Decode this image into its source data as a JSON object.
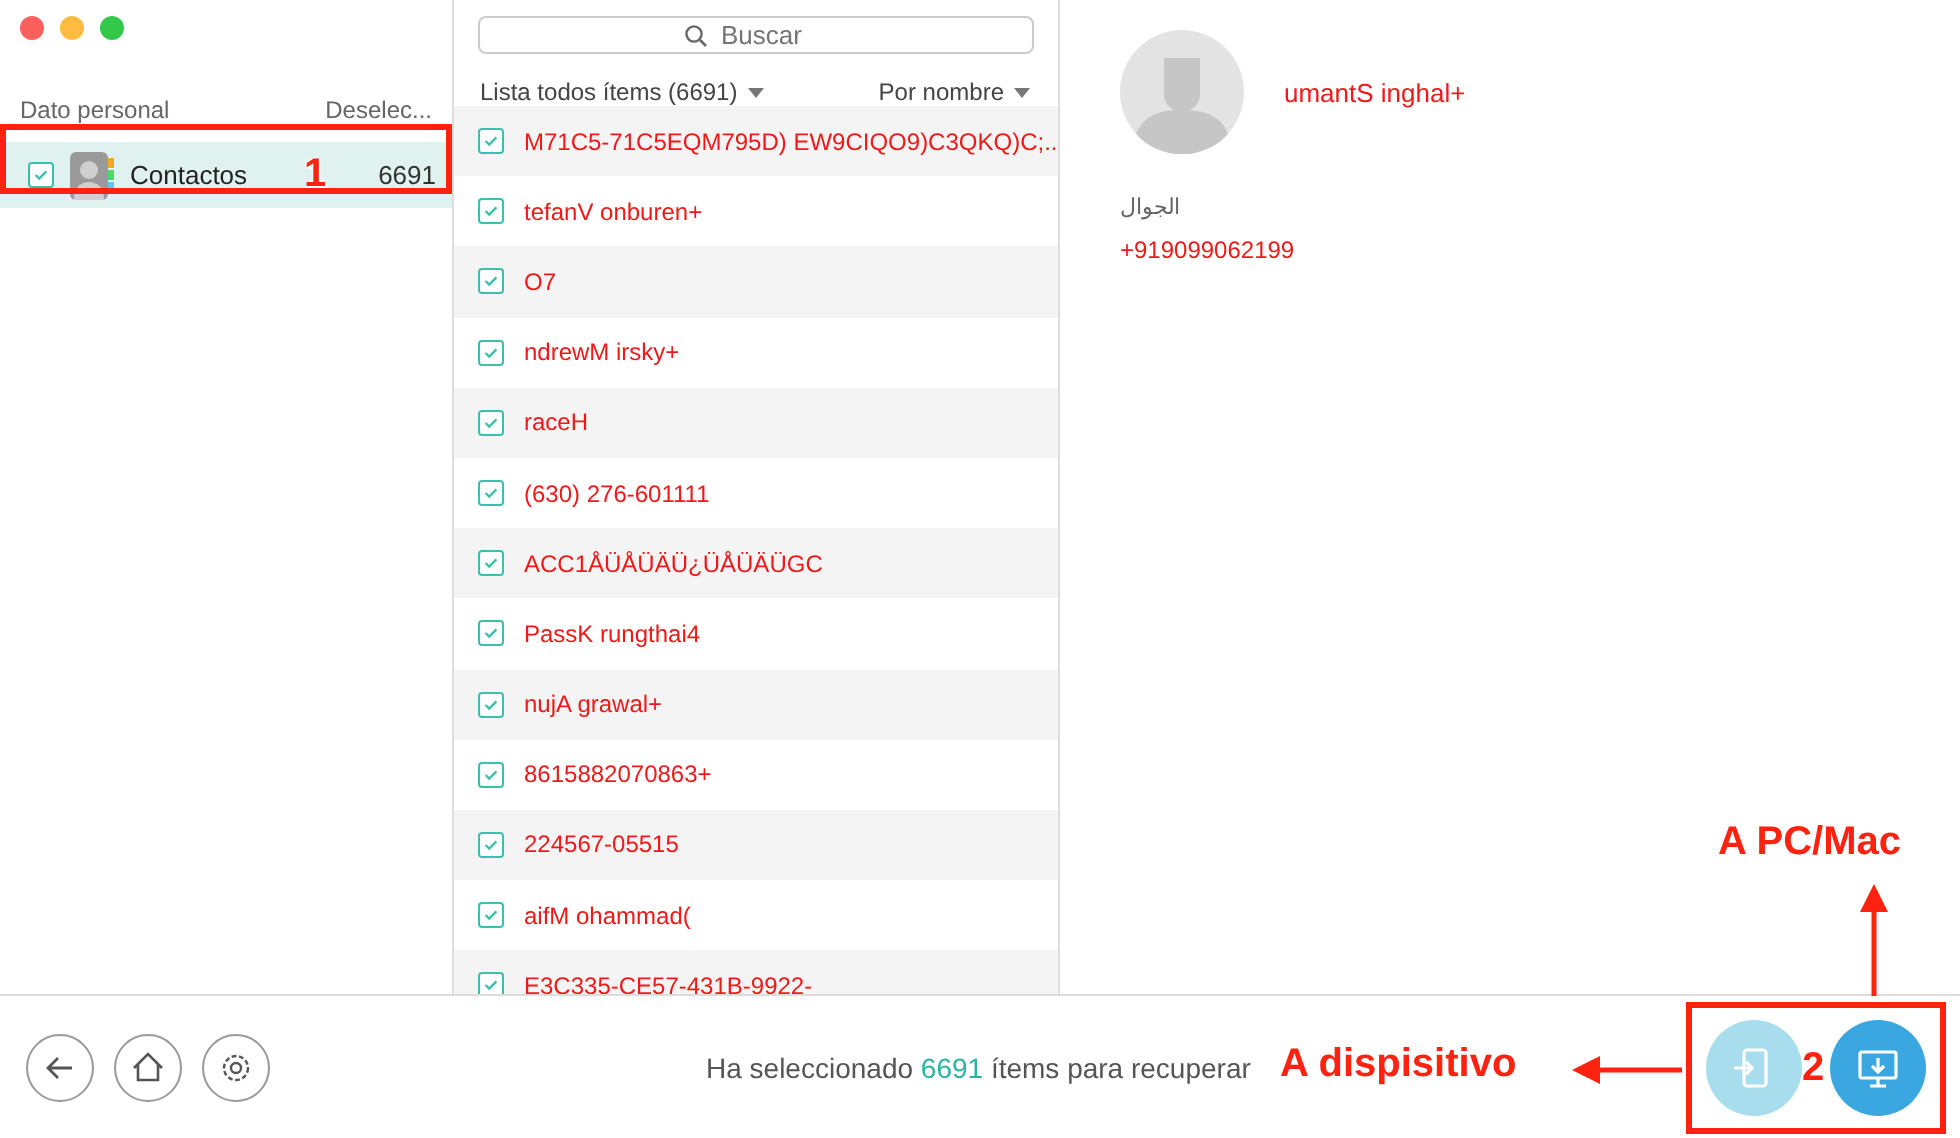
{
  "sidebar": {
    "heading": "Dato personal",
    "action": "Deselec...",
    "items": [
      {
        "label": "Contactos",
        "count": "6691",
        "checked": true,
        "selected": true,
        "badge": "1"
      }
    ]
  },
  "search": {
    "placeholder": "Buscar"
  },
  "list": {
    "filter": "Lista todos ítems (6691)",
    "sort": "Por nombre",
    "rows": [
      {
        "label": "M71C5-71C5EQM795D) EW9CIQO9)C3QKQ)C;...",
        "checked": true,
        "deleted": true
      },
      {
        "label": "tefanV onburen+",
        "checked": true,
        "deleted": true
      },
      {
        "label": "O7",
        "checked": true,
        "deleted": true
      },
      {
        "label": "ndrewM irsky+",
        "checked": true,
        "deleted": true
      },
      {
        "label": "raceH",
        "checked": true,
        "deleted": true
      },
      {
        "label": " (630) 276-601111",
        "checked": true,
        "deleted": true
      },
      {
        "label": "ACC1ÅÜÅÜÄÜ¿ÜÅÜÄÜGC",
        "checked": true,
        "deleted": true
      },
      {
        "label": "PassK rungthai4",
        "checked": true,
        "deleted": true
      },
      {
        "label": "nujA grawal+",
        "checked": true,
        "deleted": true
      },
      {
        "label": "8615882070863+",
        "checked": true,
        "deleted": true
      },
      {
        "label": "224567-05515",
        "checked": true,
        "deleted": true
      },
      {
        "label": "aifM ohammad(",
        "checked": true,
        "deleted": true
      },
      {
        "label": "E3C335-CE57-431B-9922-",
        "checked": true,
        "deleted": true
      }
    ]
  },
  "detail": {
    "name": "umantS inghal+",
    "deleted": true,
    "fields": [
      {
        "label": "الجوال",
        "value": "+919099062199"
      }
    ]
  },
  "status_bar": {
    "message": "Ha seleccionado **6691** ítems para recuperar",
    "buttons": [
      {
        "kind": "to-device",
        "label": "A dispisitivo"
      },
      {
        "kind": "to-computer",
        "label": "A PC/Mac"
      }
    ],
    "badge": "2"
  }
}
